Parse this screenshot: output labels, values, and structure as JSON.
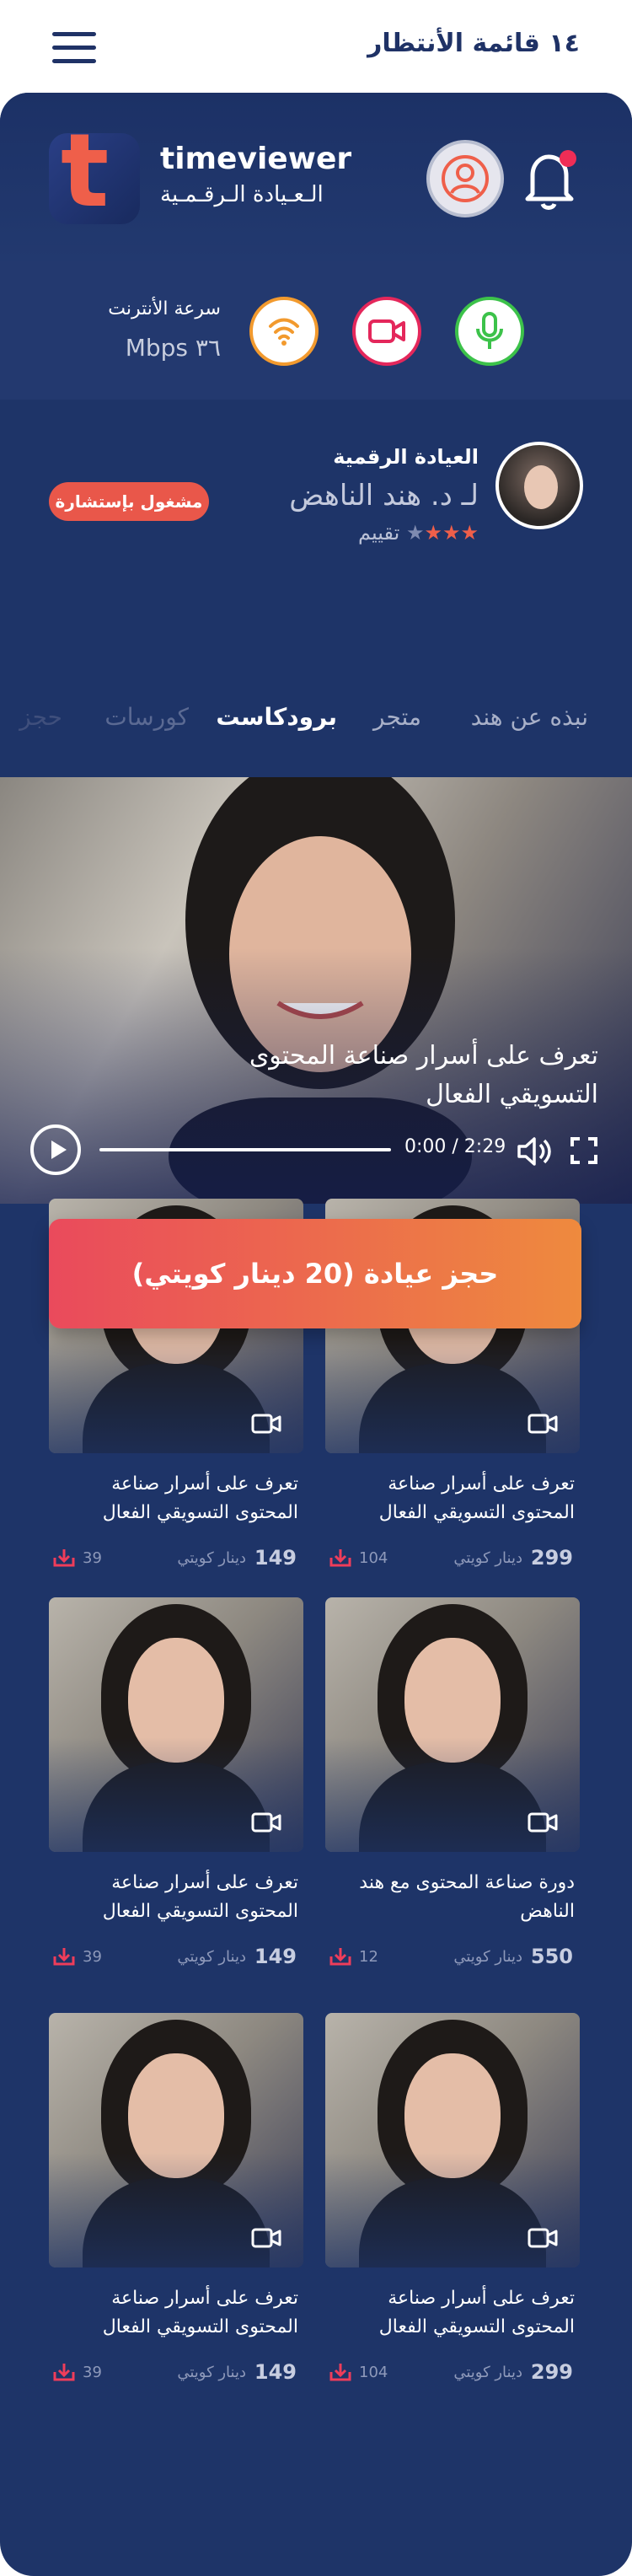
{
  "header": {
    "waitlist_label": "١٤ قائمة الأنتظار"
  },
  "brand": {
    "name": "timeviewer",
    "subtitle": "الـعـيادة الـرقـمـية",
    "logo_letter": "t"
  },
  "connection": {
    "label": "سرعة الأنترنت",
    "speed": "٣٦ Mbps"
  },
  "doctor": {
    "clinic": "العيادة الرقمية",
    "name": "لـ د. هند الناهض",
    "rating_text": "تقييم",
    "stars_on": 3,
    "stars_total": 4,
    "status_badge": "مشغول بإستشارة"
  },
  "tabs": [
    {
      "label": "نبذه عن هند",
      "active": false
    },
    {
      "label": "متجر",
      "active": false
    },
    {
      "label": "برودكاست",
      "active": true
    },
    {
      "label": "كورسات",
      "active": false
    },
    {
      "label": "حجز",
      "active": false
    }
  ],
  "video": {
    "title": "تعرف على أسرار صناعة المحتوى التسويقي الفعال",
    "time": "0:00 / 2:29",
    "progress": 0
  },
  "booking": {
    "label": "حجز عيادة (20 دينار كويتي)"
  },
  "cards": [
    {
      "title": "تعرف على أسرار صناعة المحتوى التسويقي الفعال",
      "price": "299",
      "currency": "دينار كويتي",
      "downloads": "104"
    },
    {
      "title": "تعرف على أسرار صناعة المحتوى التسويقي الفعال",
      "price": "149",
      "currency": "دينار كويتي",
      "downloads": "39"
    },
    {
      "title": "دورة صناعة المحتوى مع هند الناهض",
      "price": "550",
      "currency": "دينار كويتي",
      "downloads": "12"
    },
    {
      "title": "تعرف على أسرار صناعة المحتوى التسويقي الفعال",
      "price": "149",
      "currency": "دينار كويتي",
      "downloads": "39"
    },
    {
      "title": "تعرف على أسرار صناعة المحتوى التسويقي الفعال",
      "price": "299",
      "currency": "دينار كويتي",
      "downloads": "104"
    },
    {
      "title": "تعرف على أسرار صناعة المحتوى التسويقي الفعال",
      "price": "149",
      "currency": "دينار كويتي",
      "downloads": "39"
    }
  ],
  "colors": {
    "panel": "#1e3468",
    "accent_orange": "#ef5f4a",
    "wifi": "#f29a2e",
    "camera": "#e4275b",
    "mic": "#3cc24a"
  },
  "icons": [
    "menu-icon",
    "profile-icon",
    "bell-icon",
    "wifi-icon",
    "video-camera-icon",
    "microphone-icon",
    "play-icon",
    "volume-icon",
    "fullscreen-icon",
    "download-icon"
  ]
}
